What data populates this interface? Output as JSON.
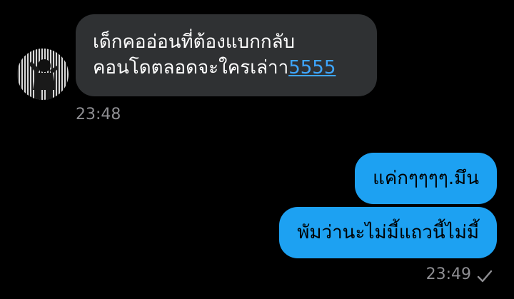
{
  "conversation": {
    "incoming": {
      "line1": "เด็กคออ่อนที่ต้องแบกกลับ",
      "line2_text": "คอนโดตลอดจะใครเล่าา",
      "line2_link": "5555",
      "time": "23:48"
    },
    "outgoing": [
      {
        "text": "แค่กๆๆๆๆ.มึน"
      },
      {
        "text": "พัมว่านะไม่มี้แถวนี้ไม่มี้"
      }
    ],
    "outgoing_time": "23:49",
    "status_icon": "checkmark-icon"
  },
  "colors": {
    "background": "#000000",
    "incoming_bubble": "#2f3133",
    "outgoing_bubble": "#1da1f2",
    "link": "#3ea6ff",
    "timestamp": "#8e8e92"
  }
}
